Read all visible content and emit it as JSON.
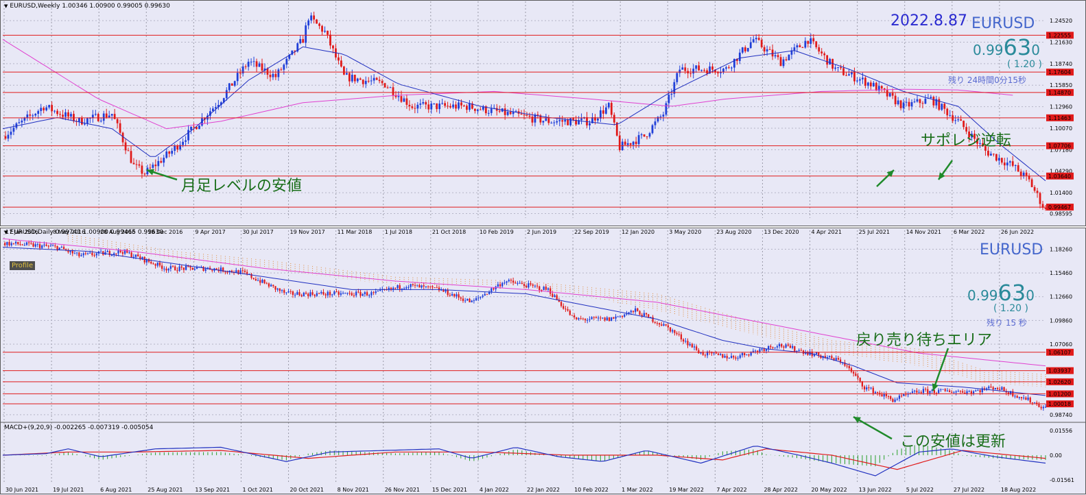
{
  "top_chart": {
    "header": "EURUSD,Weekly  1.00346 1.00900 0.99005 0.99630",
    "date_label": "2022.8.87",
    "symbol": "EURUSD",
    "price_small": "0.99",
    "price_big": "63",
    "price_tail": "0",
    "spread": "( 1.20 )",
    "remaining": "残り 24時間0分15秒",
    "note_low": "月足レベルの安値",
    "note_flip": "サポレジ逆転"
  },
  "bottom_chart": {
    "header": "EURUSD,Daily  0.99741 1.00900 0.99465 0.99630",
    "profile_label": "Profile",
    "symbol": "EURUSD",
    "price_small": "0.99",
    "price_big": "63",
    "price_tail": "0",
    "spread": "( 1.20 )",
    "remaining": "残り 15 秒",
    "note_wait": "戻り売り待ちエリア",
    "note_low": "この安値は更新",
    "macd_header": "MACD+(9,20,9) -0.002265 -0.007319 -0.005054"
  },
  "chart_data": [
    {
      "type": "candlestick",
      "symbol": "EURUSD",
      "timeframe": "Weekly",
      "ohlc_last": {
        "open": 1.00346,
        "high": 1.009,
        "low": 0.99005,
        "close": 0.9963
      },
      "ylim": [
        0.98,
        1.26
      ],
      "y_ticks": [
        "1.24520",
        "1.21630",
        "1.18740",
        "1.15850",
        "1.12960",
        "1.10070",
        "1.07180",
        "1.04290",
        "1.01400",
        "0.98595"
      ],
      "x_ticks": [
        "17 Jan 2016",
        "8 May 2016",
        "28 Aug 2016",
        "18 Dec 2016",
        "9 Apr 2017",
        "30 Jul 2017",
        "19 Nov 2017",
        "11 Mar 2018",
        "1 Jul 2018",
        "21 Oct 2018",
        "10 Feb 2019",
        "2 Jun 2019",
        "22 Sep 2019",
        "12 Jan 2020",
        "3 May 2020",
        "23 Aug 2020",
        "13 Dec 2020",
        "4 Apr 2021",
        "25 Jul 2021",
        "14 Nov 2021",
        "6 Mar 2022",
        "26 Jun 2022"
      ],
      "horizontal_levels": [
        {
          "value": 1.22555,
          "label": "1.22555"
        },
        {
          "value": 1.17604,
          "label": "1.17604"
        },
        {
          "value": 1.1487,
          "label": "1.14870"
        },
        {
          "value": 1.11463,
          "label": "1.11463"
        },
        {
          "value": 1.07706,
          "label": "1.07706"
        },
        {
          "value": 1.0364,
          "label": "1.03640"
        },
        {
          "value": 0.99467,
          "label": "0.99467"
        }
      ],
      "price_path": [
        [
          0,
          1.09
        ],
        [
          15,
          1.13
        ],
        [
          28,
          1.11
        ],
        [
          40,
          1.12
        ],
        [
          48,
          1.05
        ],
        [
          52,
          1.04
        ],
        [
          62,
          1.07
        ],
        [
          80,
          1.14
        ],
        [
          90,
          1.19
        ],
        [
          100,
          1.17
        ],
        [
          110,
          1.22
        ],
        [
          112,
          1.25
        ],
        [
          118,
          1.23
        ],
        [
          125,
          1.17
        ],
        [
          140,
          1.16
        ],
        [
          150,
          1.13
        ],
        [
          170,
          1.13
        ],
        [
          185,
          1.12
        ],
        [
          200,
          1.11
        ],
        [
          215,
          1.11
        ],
        [
          222,
          1.13
        ],
        [
          226,
          1.075
        ],
        [
          235,
          1.09
        ],
        [
          242,
          1.12
        ],
        [
          248,
          1.18
        ],
        [
          265,
          1.18
        ],
        [
          275,
          1.22
        ],
        [
          285,
          1.19
        ],
        [
          295,
          1.22
        ],
        [
          305,
          1.18
        ],
        [
          318,
          1.16
        ],
        [
          330,
          1.13
        ],
        [
          340,
          1.14
        ],
        [
          350,
          1.11
        ],
        [
          360,
          1.07
        ],
        [
          370,
          1.05
        ],
        [
          376,
          1.03
        ],
        [
          382,
          0.99
        ]
      ],
      "ma_fast_path": [
        [
          0,
          1.1
        ],
        [
          20,
          1.115
        ],
        [
          40,
          1.1
        ],
        [
          55,
          1.06
        ],
        [
          70,
          1.1
        ],
        [
          90,
          1.165
        ],
        [
          110,
          1.21
        ],
        [
          125,
          1.2
        ],
        [
          145,
          1.16
        ],
        [
          175,
          1.13
        ],
        [
          200,
          1.115
        ],
        [
          225,
          1.105
        ],
        [
          245,
          1.15
        ],
        [
          270,
          1.195
        ],
        [
          290,
          1.205
        ],
        [
          310,
          1.18
        ],
        [
          330,
          1.15
        ],
        [
          350,
          1.13
        ],
        [
          365,
          1.08
        ],
        [
          382,
          1.03
        ]
      ],
      "ma_slow_path": [
        [
          0,
          1.22
        ],
        [
          35,
          1.14
        ],
        [
          60,
          1.1
        ],
        [
          80,
          1.11
        ],
        [
          110,
          1.135
        ],
        [
          145,
          1.145
        ],
        [
          180,
          1.15
        ],
        [
          215,
          1.14
        ],
        [
          245,
          1.13
        ],
        [
          265,
          1.14
        ],
        [
          300,
          1.15
        ],
        [
          330,
          1.153
        ],
        [
          350,
          1.152
        ],
        [
          370,
          1.145
        ]
      ]
    },
    {
      "type": "candlestick",
      "symbol": "EURUSD",
      "timeframe": "Daily",
      "ohlc_last": {
        "open": 0.99741,
        "high": 1.009,
        "low": 0.99465,
        "close": 0.9963
      },
      "ylim": [
        0.98,
        1.2
      ],
      "y_ticks": [
        "1.18260",
        "1.15460",
        "1.12660",
        "1.09860",
        "1.07060",
        "0.98740"
      ],
      "x_ticks": [
        "30 Jun 2021",
        "19 Jul 2021",
        "6 Aug 2021",
        "25 Aug 2021",
        "13 Sep 2021",
        "1 Oct 2021",
        "20 Oct 2021",
        "8 Nov 2021",
        "26 Nov 2021",
        "15 Dec 2021",
        "4 Jan 2022",
        "22 Jan 2022",
        "10 Feb 2022",
        "1 Mar 2022",
        "19 Mar 2022",
        "7 Apr 2022",
        "28 Apr 2022",
        "20 May 2022",
        "13 Jun 2022",
        "5 Jul 2022",
        "27 Jul 2022",
        "18 Aug 2022"
      ],
      "horizontal_levels": [
        {
          "value": 1.06107,
          "label": "1.06107"
        },
        {
          "value": 1.03937,
          "label": "1.03937"
        },
        {
          "value": 1.0262,
          "label": "1.02620"
        },
        {
          "value": 1.012,
          "label": "1.01200"
        },
        {
          "value": 1.00018,
          "label": "1.00018"
        }
      ],
      "price_path": [
        [
          0,
          1.19
        ],
        [
          25,
          1.185
        ],
        [
          35,
          1.175
        ],
        [
          55,
          1.18
        ],
        [
          75,
          1.16
        ],
        [
          95,
          1.16
        ],
        [
          110,
          1.155
        ],
        [
          130,
          1.13
        ],
        [
          150,
          1.13
        ],
        [
          170,
          1.13
        ],
        [
          185,
          1.14
        ],
        [
          200,
          1.135
        ],
        [
          215,
          1.12
        ],
        [
          230,
          1.145
        ],
        [
          250,
          1.135
        ],
        [
          262,
          1.1
        ],
        [
          278,
          1.1
        ],
        [
          290,
          1.11
        ],
        [
          305,
          1.09
        ],
        [
          320,
          1.06
        ],
        [
          335,
          1.055
        ],
        [
          355,
          1.07
        ],
        [
          370,
          1.06
        ],
        [
          385,
          1.05
        ],
        [
          395,
          1.02
        ],
        [
          408,
          1.005
        ],
        [
          420,
          1.015
        ],
        [
          445,
          1.015
        ],
        [
          455,
          1.02
        ],
        [
          470,
          1.005
        ],
        [
          478,
          0.995
        ]
      ],
      "ma_path": [
        [
          0,
          1.185
        ],
        [
          40,
          1.18
        ],
        [
          80,
          1.165
        ],
        [
          120,
          1.15
        ],
        [
          160,
          1.135
        ],
        [
          200,
          1.135
        ],
        [
          240,
          1.13
        ],
        [
          270,
          1.115
        ],
        [
          300,
          1.1
        ],
        [
          330,
          1.075
        ],
        [
          350,
          1.065
        ],
        [
          370,
          1.06
        ],
        [
          390,
          1.045
        ],
        [
          410,
          1.025
        ],
        [
          440,
          1.02
        ],
        [
          478,
          1.01
        ]
      ],
      "ma_slow_path": [
        [
          0,
          1.195
        ],
        [
          60,
          1.18
        ],
        [
          120,
          1.16
        ],
        [
          180,
          1.145
        ],
        [
          240,
          1.135
        ],
        [
          300,
          1.12
        ],
        [
          360,
          1.09
        ],
        [
          420,
          1.06
        ],
        [
          478,
          1.045
        ]
      ],
      "cloud_upper_path": [
        [
          30,
          1.2
        ],
        [
          80,
          1.18
        ],
        [
          120,
          1.17
        ],
        [
          180,
          1.15
        ],
        [
          240,
          1.145
        ],
        [
          300,
          1.13
        ],
        [
          340,
          1.1
        ],
        [
          380,
          1.075
        ],
        [
          420,
          1.065
        ],
        [
          450,
          1.04
        ],
        [
          478,
          1.035
        ]
      ],
      "cloud_lower_path": [
        [
          30,
          1.19
        ],
        [
          80,
          1.17
        ],
        [
          120,
          1.16
        ],
        [
          180,
          1.14
        ],
        [
          240,
          1.14
        ],
        [
          300,
          1.11
        ],
        [
          340,
          1.085
        ],
        [
          380,
          1.06
        ],
        [
          420,
          1.045
        ],
        [
          450,
          1.025
        ],
        [
          478,
          1.02
        ]
      ]
    },
    {
      "type": "line",
      "name": "MACD+(9,20,9)",
      "values_last": [
        -0.002265,
        -0.007319,
        -0.005054
      ],
      "ylim": [
        -0.01561,
        0.01556
      ],
      "y_ticks": [
        "0.01556",
        "0.00",
        "-0.01561"
      ],
      "macd_path": [
        [
          0,
          0.0
        ],
        [
          20,
          0.001
        ],
        [
          30,
          0.004
        ],
        [
          45,
          -0.001
        ],
        [
          70,
          0.004
        ],
        [
          100,
          0.005
        ],
        [
          130,
          -0.004
        ],
        [
          150,
          0.002
        ],
        [
          175,
          0.003
        ],
        [
          200,
          0.004
        ],
        [
          215,
          -0.002
        ],
        [
          235,
          0.005
        ],
        [
          255,
          -0.001
        ],
        [
          275,
          -0.004
        ],
        [
          295,
          0.003
        ],
        [
          320,
          -0.005
        ],
        [
          345,
          0.006
        ],
        [
          365,
          0.0
        ],
        [
          380,
          -0.005
        ],
        [
          400,
          -0.013
        ],
        [
          420,
          0.002
        ],
        [
          435,
          0.004
        ],
        [
          455,
          -0.001
        ],
        [
          478,
          -0.005
        ]
      ],
      "signal_path": [
        [
          0,
          0.0
        ],
        [
          30,
          0.002
        ],
        [
          60,
          0.002
        ],
        [
          100,
          0.003
        ],
        [
          140,
          -0.002
        ],
        [
          180,
          0.002
        ],
        [
          220,
          0.002
        ],
        [
          260,
          0.0
        ],
        [
          300,
          0.0
        ],
        [
          330,
          -0.003
        ],
        [
          350,
          0.004
        ],
        [
          380,
          0.0
        ],
        [
          410,
          -0.009
        ],
        [
          440,
          0.003
        ],
        [
          478,
          -0.002
        ]
      ]
    }
  ]
}
